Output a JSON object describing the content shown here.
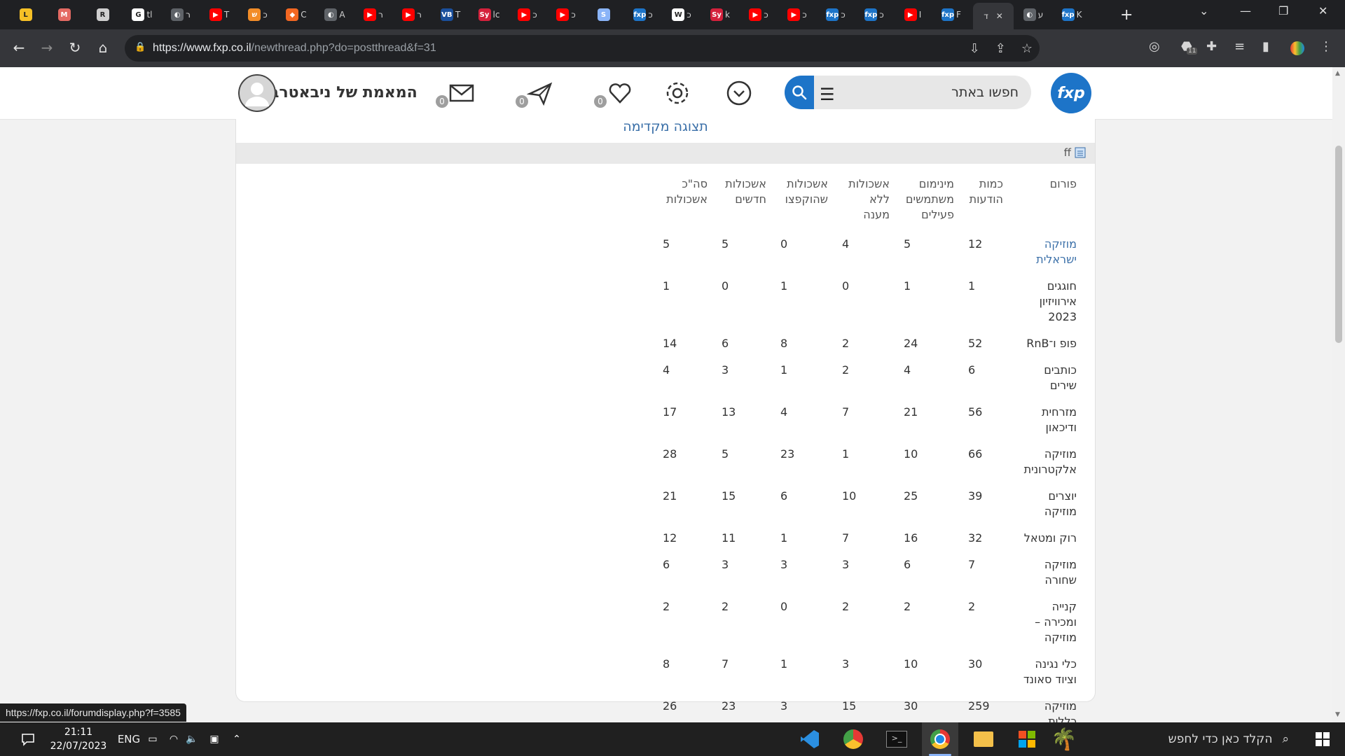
{
  "browser": {
    "tabs": [
      {
        "letter": "L",
        "color": "#f6c026",
        "text": ""
      },
      {
        "letter": "M",
        "color": "#e46a63",
        "text": ""
      },
      {
        "letter": "R",
        "color": "#cfcfcf",
        "text": ""
      },
      {
        "letter": "G",
        "color": "#ffffff",
        "text": "tl"
      },
      {
        "letter": "◐",
        "color": "#5f6368",
        "text": "ר"
      },
      {
        "letter": "▶",
        "color": "#ff0000",
        "text": "T"
      },
      {
        "letter": "ש",
        "color": "#f28c28",
        "text": "כ"
      },
      {
        "letter": "◆",
        "color": "#f26722",
        "text": "C"
      },
      {
        "letter": "◐",
        "color": "#5f6368",
        "text": "A"
      },
      {
        "letter": "▶",
        "color": "#ff0000",
        "text": "ר"
      },
      {
        "letter": "▶",
        "color": "#ff0000",
        "text": "ר"
      },
      {
        "letter": "VB",
        "color": "#1a4f9c",
        "text": "T"
      },
      {
        "letter": "Sy",
        "color": "#d4213c",
        "text": "lc"
      },
      {
        "letter": "▶",
        "color": "#ff0000",
        "text": "כ"
      },
      {
        "letter": "▶",
        "color": "#ff0000",
        "text": "כ"
      },
      {
        "letter": "S",
        "color": "#8ab4f8",
        "text": ""
      },
      {
        "letter": "fxp",
        "color": "#1d74c8",
        "text": "כ"
      },
      {
        "letter": "W",
        "color": "#ffffff",
        "text": "כ"
      },
      {
        "letter": "Sy",
        "color": "#d4213c",
        "text": "k"
      },
      {
        "letter": "▶",
        "color": "#ff0000",
        "text": "כ"
      },
      {
        "letter": "▶",
        "color": "#ff0000",
        "text": "כ"
      },
      {
        "letter": "fxp",
        "color": "#1d74c8",
        "text": "כ"
      },
      {
        "letter": "fxp",
        "color": "#1d74c8",
        "text": "כ"
      },
      {
        "letter": "▶",
        "color": "#ff0000",
        "text": "I"
      },
      {
        "letter": "fxp",
        "color": "#1d74c8",
        "text": "F"
      },
      {
        "letter": "",
        "color": "#35363a",
        "text": "ד"
      },
      {
        "letter": "◐",
        "color": "#5f6368",
        "text": "ע"
      },
      {
        "letter": "fxp",
        "color": "#1d74c8",
        "text": "K"
      }
    ],
    "active_tab_close": "✕",
    "new_tab": "+",
    "url_host": "https://www.fxp.co.il",
    "url_path": "/newthread.php?do=postthread&f=31",
    "ext_badge": "11"
  },
  "site": {
    "logo_text": "fxp",
    "search_placeholder": "חפשו באתר",
    "username": "המאמת של ניבאטרב",
    "badges": {
      "alerts": "0",
      "messages": "0",
      "mail": "0"
    }
  },
  "preview": {
    "title": "תצוגה מקדימה",
    "post_title": "ff"
  },
  "table": {
    "headers": [
      "פורום",
      "כמות הודעות",
      "מינימום משתמשים פעילים",
      "אשכולות ללא מענה",
      "אשכולות שהוקפצו",
      "אשכולות חדשים",
      "סה\"כ אשכולות"
    ],
    "rows": [
      {
        "forum": "מוזיקה ישראלית",
        "link": true,
        "values": [
          "12",
          "5",
          "4",
          "0",
          "5",
          "5"
        ]
      },
      {
        "forum": "חוגגים אירוויזיון 2023",
        "link": false,
        "values": [
          "1",
          "1",
          "0",
          "1",
          "0",
          "1"
        ]
      },
      {
        "forum": "פופ ו־RnB",
        "link": false,
        "values": [
          "52",
          "24",
          "2",
          "8",
          "6",
          "14"
        ]
      },
      {
        "forum": "כותבים שירים",
        "link": false,
        "values": [
          "6",
          "4",
          "2",
          "1",
          "3",
          "4"
        ]
      },
      {
        "forum": "מזרחית ודיכאון",
        "link": false,
        "values": [
          "56",
          "21",
          "7",
          "4",
          "13",
          "17"
        ]
      },
      {
        "forum": "מוזיקה אלקטרונית",
        "link": false,
        "values": [
          "66",
          "10",
          "1",
          "23",
          "5",
          "28"
        ]
      },
      {
        "forum": "יוצרים מוזיקה",
        "link": false,
        "values": [
          "39",
          "25",
          "10",
          "6",
          "15",
          "21"
        ]
      },
      {
        "forum": "רוק ומטאל",
        "link": false,
        "values": [
          "32",
          "16",
          "7",
          "1",
          "11",
          "12"
        ]
      },
      {
        "forum": "מוזיקה שחורה",
        "link": false,
        "values": [
          "7",
          "6",
          "3",
          "3",
          "3",
          "6"
        ]
      },
      {
        "forum": "קנייה ומכירה – מוזיקה",
        "link": false,
        "values": [
          "2",
          "2",
          "2",
          "0",
          "2",
          "2"
        ]
      },
      {
        "forum": "כלי נגינה וציוד סאונד",
        "link": false,
        "values": [
          "30",
          "10",
          "3",
          "1",
          "7",
          "8"
        ]
      },
      {
        "forum": "מוזיקה כללית",
        "link": false,
        "values": [
          "259",
          "30",
          "15",
          "3",
          "23",
          "26"
        ]
      }
    ]
  },
  "status_link": "https://fxp.co.il/forumdisplay.php?f=3585",
  "taskbar": {
    "time": "21:11",
    "date": "22/07/2023",
    "lang": "ENG",
    "search_text": "הקלד כאן כדי לחפש"
  }
}
